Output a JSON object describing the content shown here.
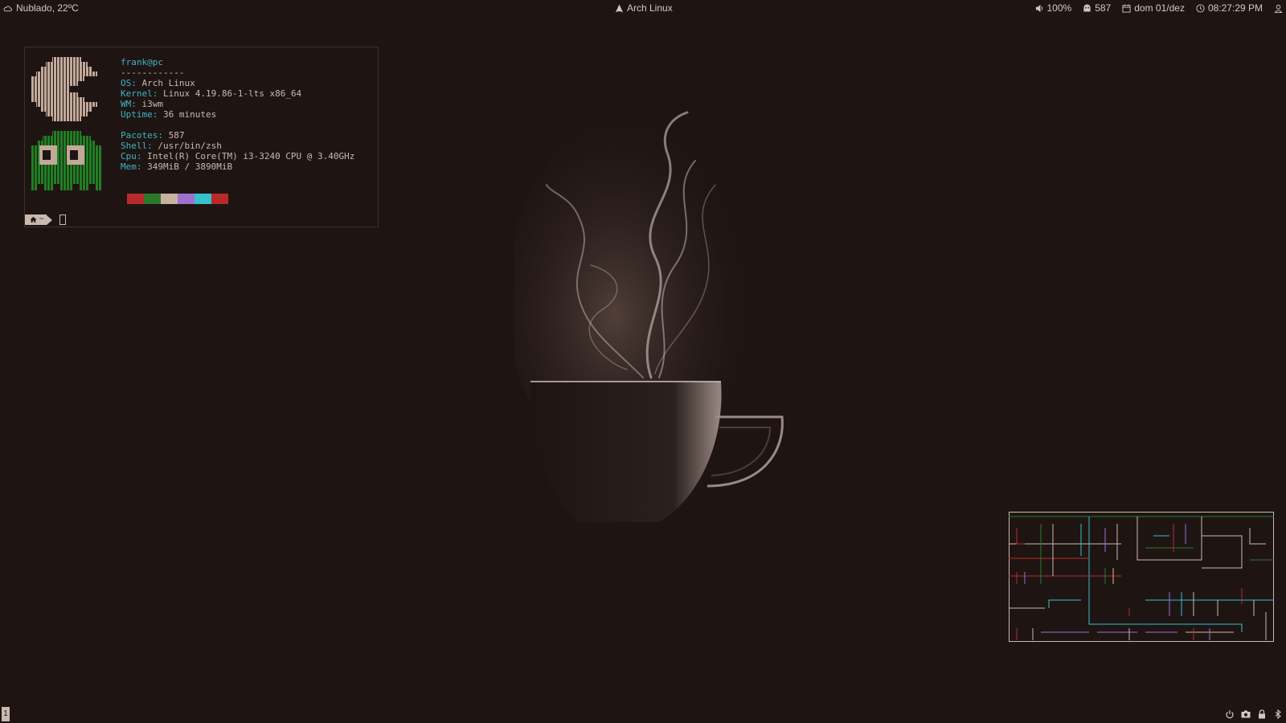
{
  "topbar": {
    "weather": "Nublado, 22ºC",
    "title": "Arch Linux",
    "volume": "100%",
    "packages": "587",
    "date": "dom 01/dez",
    "time": "08:27:29 PM"
  },
  "terminal": {
    "user": "frank@pc",
    "separator": "------------",
    "lines": [
      {
        "label": "OS",
        "value": " Arch Linux"
      },
      {
        "label": "Kernel",
        "value": " Linux 4.19.86-1-lts x86_64"
      },
      {
        "label": "WM",
        "value": " i3wm"
      },
      {
        "label": "Uptime",
        "value": " 36 minutes"
      },
      {
        "label": "Pacotes",
        "value": " 587"
      },
      {
        "label": "Shell",
        "value": " /usr/bin/zsh"
      },
      {
        "label": "Cpu",
        "value": " Intel(R) Core(TM) i3-3240 CPU @ 3.40GHz"
      },
      {
        "label": "Mem",
        "value": " 349MiB / 3890MiB"
      }
    ],
    "palette": [
      "#b82a2a",
      "#2a7a2a",
      "#c9b1a2",
      "#a070d0",
      "#35c0cc"
    ],
    "prompt_path": "~"
  },
  "workspace": "1",
  "icons": {
    "weather": "cloud-icon",
    "arch": "arch-logo-icon",
    "volume": "volume-icon",
    "packages": "ghost-icon",
    "calendar": "calendar-icon",
    "clock": "clock-icon",
    "user": "user-icon",
    "power": "power-icon",
    "screenshot": "camera-icon",
    "lock": "lock-icon",
    "bluetooth": "bluetooth-icon"
  }
}
